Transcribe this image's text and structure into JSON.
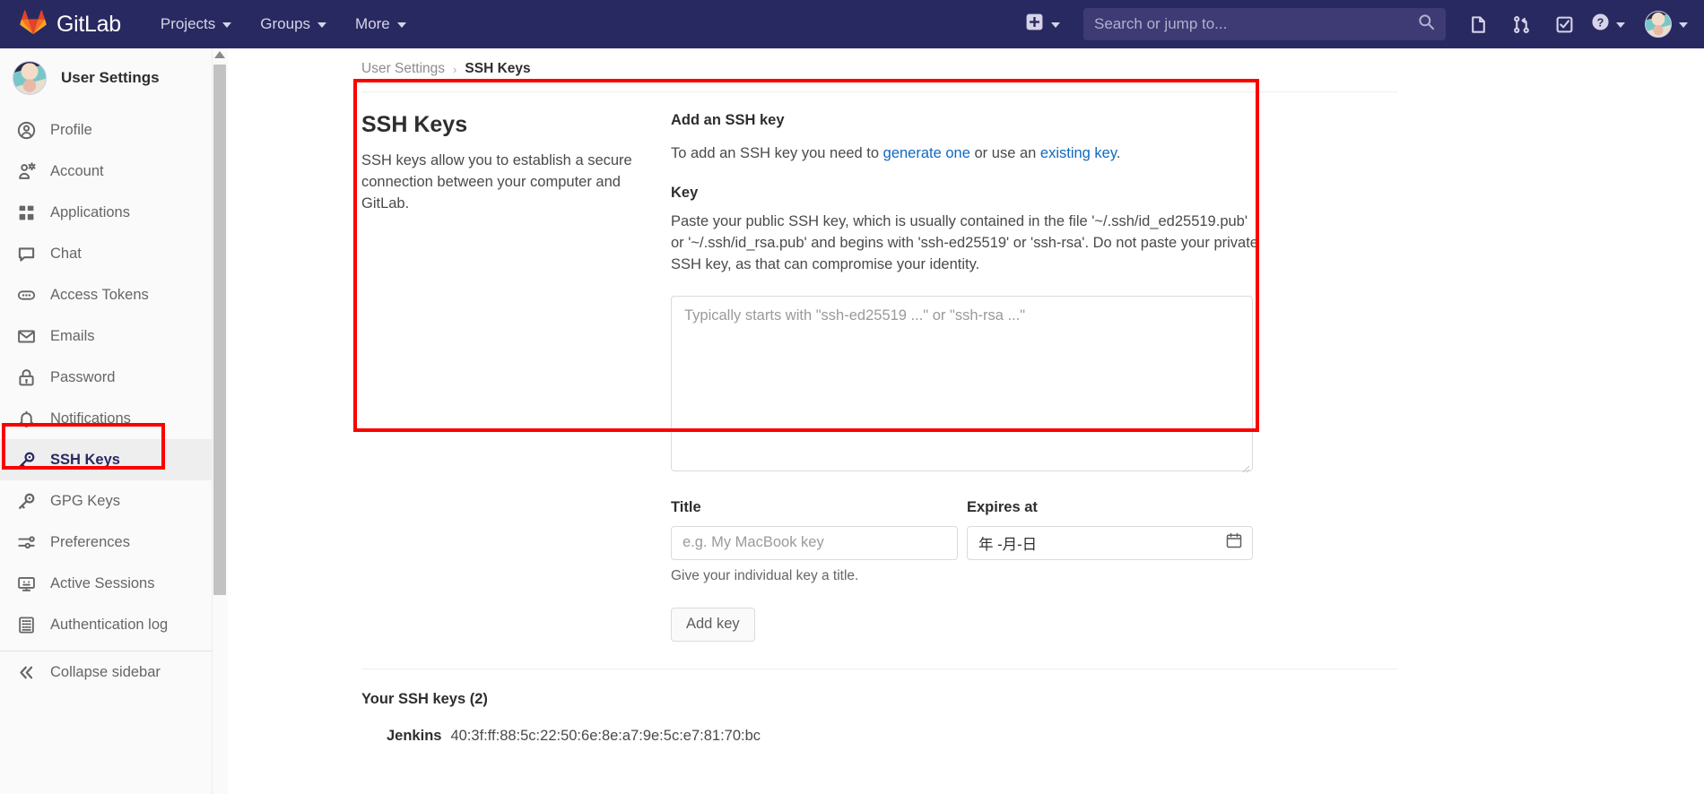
{
  "navbar": {
    "brand": "GitLab",
    "brand_icon": "gitlab-fox-logo-icon",
    "items": [
      {
        "label": "Projects",
        "icon": "chevron-down-icon"
      },
      {
        "label": "Groups",
        "icon": "chevron-down-icon"
      },
      {
        "label": "More",
        "icon": "chevron-down-icon"
      }
    ],
    "create_new_label": "",
    "search": {
      "placeholder": "Search or jump to...",
      "value": "",
      "icon": "search-icon"
    },
    "icons": [
      {
        "name": "issues-icon",
        "label": "Issues"
      },
      {
        "name": "merge-requests-icon",
        "label": "Merge requests"
      },
      {
        "name": "todos-icon",
        "label": "To-Do List"
      },
      {
        "name": "help-icon",
        "label": "Help"
      }
    ],
    "avatar_name": "user-avatar",
    "colors": {
      "bg": "#292961",
      "search_bg": "#3d3a74",
      "text": "#d6d3e8"
    }
  },
  "sidebar": {
    "title": "User Settings",
    "items": [
      {
        "label": "Profile",
        "icon": "profile-user-circle-icon",
        "active": false
      },
      {
        "label": "Account",
        "icon": "account-user-gear-icon",
        "active": false
      },
      {
        "label": "Applications",
        "icon": "applications-grid-icon",
        "active": false
      },
      {
        "label": "Chat",
        "icon": "chat-bubble-icon",
        "active": false
      },
      {
        "label": "Access Tokens",
        "icon": "access-tokens-icon",
        "active": false
      },
      {
        "label": "Emails",
        "icon": "email-envelope-icon",
        "active": false
      },
      {
        "label": "Password",
        "icon": "password-lock-icon",
        "active": false
      },
      {
        "label": "Notifications",
        "icon": "notifications-bell-icon",
        "active": false
      },
      {
        "label": "SSH Keys",
        "icon": "ssh-key-icon",
        "active": true
      },
      {
        "label": "GPG Keys",
        "icon": "gpg-key-icon",
        "active": false
      },
      {
        "label": "Preferences",
        "icon": "preferences-sliders-icon",
        "active": false
      },
      {
        "label": "Active Sessions",
        "icon": "active-sessions-monitor-icon",
        "active": false
      },
      {
        "label": "Authentication log",
        "icon": "authentication-log-icon",
        "active": false
      }
    ],
    "collapse_label": "Collapse sidebar",
    "collapse_icon": "double-chevron-left-icon"
  },
  "breadcrumb": {
    "parent": "User Settings",
    "separator": "›",
    "current": "SSH Keys"
  },
  "main": {
    "section_title": "SSH Keys",
    "section_desc": "SSH keys allow you to establish a secure connection between your computer and GitLab.",
    "form": {
      "heading": "Add an SSH key",
      "intro_prefix": "To add an SSH key you need to ",
      "intro_link1": "generate one",
      "intro_middle": " or use an ",
      "intro_link2": "existing key",
      "intro_suffix": ".",
      "key_label": "Key",
      "key_help": "Paste your public SSH key, which is usually contained in the file '~/.ssh/id_ed25519.pub' or '~/.ssh/id_rsa.pub' and begins with 'ssh-ed25519' or 'ssh-rsa'. Do not paste your private SSH key, as that can compromise your identity.",
      "key_placeholder": "Typically starts with \"ssh-ed25519 ...\" or \"ssh-rsa ...\"",
      "key_value": "",
      "title_label": "Title",
      "title_placeholder": "e.g. My MacBook key",
      "title_value": "",
      "title_helper": "Give your individual key a title.",
      "expires_label": "Expires at",
      "expires_value": "年 -月-日",
      "expires_icon": "calendar-icon",
      "submit_label": "Add key"
    },
    "keys_list": {
      "heading": "Your SSH keys (2)",
      "rows": [
        {
          "name": "Jenkins",
          "fingerprint": "40:3f:ff:88:5c:22:50:6e:8e:a7:9e:5c:e7:81:70:bc"
        }
      ]
    }
  },
  "annotations": {
    "highlight_color": "#fc0000",
    "boxes": [
      {
        "name": "sidebar-ssh-keys-highlight"
      },
      {
        "name": "add-ssh-key-panel-highlight"
      }
    ]
  }
}
